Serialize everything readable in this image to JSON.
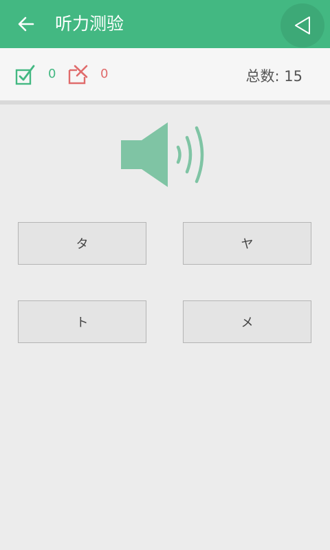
{
  "header": {
    "title": "听力测验",
    "back_icon": "arrow-left-icon",
    "float_icon": "triangle-back-icon",
    "color": "#43b882"
  },
  "stats": {
    "correct_icon": "checkbox-checked-icon",
    "correct_count": "0",
    "correct_color": "#43b882",
    "wrong_icon": "box-cross-icon",
    "wrong_count": "0",
    "wrong_color": "#e06b6b",
    "total_text": "总数: 15"
  },
  "speaker": {
    "icon": "speaker-icon",
    "color": "#7fc4a4"
  },
  "options": [
    "タ",
    "ヤ",
    "ト",
    "メ"
  ]
}
